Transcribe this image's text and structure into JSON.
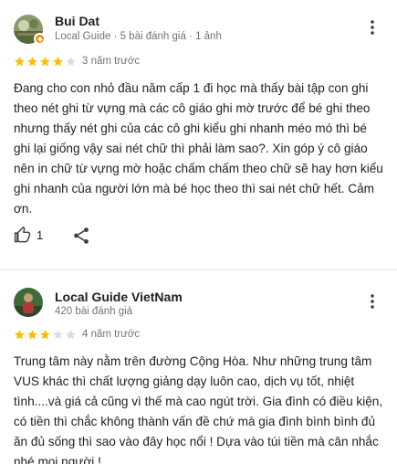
{
  "reviews": [
    {
      "reviewer_name": "Bui Dat",
      "reviewer_meta": "Local Guide · 5 bài đánh giá · 1 ảnh",
      "rating": 4,
      "max_rating": 5,
      "date": "3 năm trước",
      "text": "Đang cho con nhỏ đầu năm cấp 1 đi học mà thấy bài tập con ghi theo nét ghi từ vựng mà các cô giáo ghi mờ trước để bé ghi theo nhưng thấy nét ghi của các cô ghi kiểu ghi nhanh méo mó thì bé ghi lại giống vậy sai nét chữ thì phải làm sao?. Xin góp ý cô giáo nên in chữ từ vựng mờ hoặc chấm chấm theo chữ sẽ hay hơn kiểu ghi nhanh của người lớn mà bé học theo thì sai nét chữ hết. Cảm ơn.",
      "like_count": "1",
      "has_local_guide_badge": true
    },
    {
      "reviewer_name": "Local Guide VietNam",
      "reviewer_meta": "420 bài đánh giá",
      "rating": 3,
      "max_rating": 5,
      "date": "4 năm trước",
      "text": "Trung tâm này nằm trên đường Cộng Hòa. Như những trung tâm VUS khác thì chất lượng giảng dạy luôn cao, dịch vụ tốt, nhiệt tình....và giá cả cũng vì thế mà cao ngút trời. Gia đình có điều kiện, có tiền thì chắc không thành vấn đề chứ mà gia đình bình bình đủ ăn đủ sống thì sao vào đây học nổi ! Dựa vào túi tiền mà cân nhắc nhé mọi người !"
    }
  ],
  "icons": {
    "more": "more-vert-icon",
    "like": "thumb-up-icon",
    "share": "share-icon",
    "star": "star-icon"
  },
  "colors": {
    "star_filled": "#fbbc04",
    "star_empty": "#dadce0",
    "text": "#202124",
    "secondary_text": "#70757a",
    "local_guide_badge": "#f28b00"
  }
}
